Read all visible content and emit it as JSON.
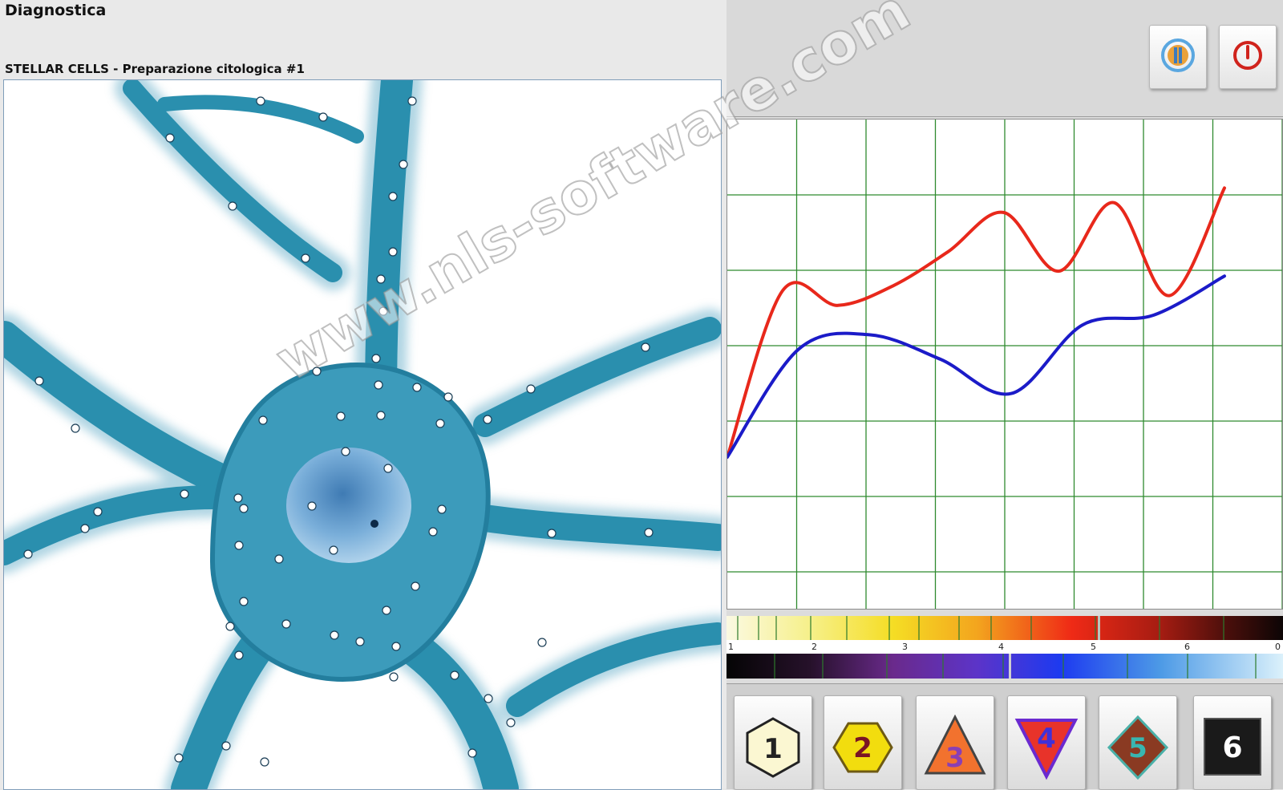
{
  "app": {
    "title": "Diagnostica"
  },
  "image_panel": {
    "caption": "STELLAR CELLS - Preparazione citologica #1"
  },
  "watermark": "www.nls-software.com",
  "toolbar": {
    "left_icon": "sound-wave-icon",
    "right_icon": "power-icon"
  },
  "chart_data": {
    "type": "line",
    "grid": true,
    "series": [
      {
        "color": "#e8281b",
        "values": [
          0.69,
          0.35,
          0.38,
          0.34,
          0.27,
          0.19,
          0.31,
          0.17,
          0.36,
          0.14
        ]
      },
      {
        "color": "#1b1bc8",
        "values": [
          0.69,
          0.47,
          0.44,
          0.49,
          0.56,
          0.42,
          0.4,
          0.32
        ]
      }
    ]
  },
  "scale": {
    "labels": [
      "1",
      "2",
      "3",
      "4",
      "5",
      "6",
      "0"
    ]
  },
  "shape_buttons": [
    {
      "label": "1",
      "icon": "hexagon-icon"
    },
    {
      "label": "2",
      "icon": "hexagon-icon"
    },
    {
      "label": "3",
      "icon": "triangle-icon"
    },
    {
      "label": "4",
      "icon": "inverted-triangle-icon"
    },
    {
      "label": "5",
      "icon": "diamond-icon"
    },
    {
      "label": "6",
      "icon": "square-icon"
    }
  ]
}
